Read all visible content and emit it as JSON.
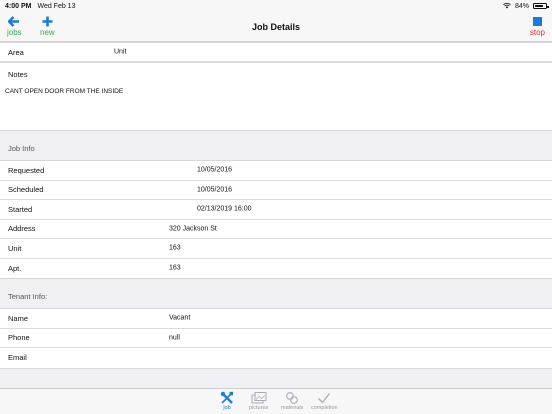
{
  "status_bar": {
    "time": "4:00 PM",
    "date": "Wed Feb 13",
    "battery": "84%",
    "battery_level": 0.84
  },
  "nav": {
    "back_label": "jobs",
    "new_label": "new",
    "title": "Job Details",
    "stop_label": "stop"
  },
  "details": {
    "area_label": "Area",
    "area_value": "Unit",
    "notes_label": "Notes",
    "notes_text": "CANT OPEN DOOR FROM THE INSIDE"
  },
  "job_info": {
    "header": "Job Info",
    "requested_label": "Requested",
    "requested_value": "10/05/2016",
    "scheduled_label": "Scheduled",
    "scheduled_value": "10/05/2016",
    "started_label": "Started",
    "started_value": "02/13/2019 16:00",
    "address_label": "Address",
    "address_value": "320 Jackson St",
    "unit_label": "Unit",
    "unit_value": "163",
    "apt_label": "Apt.",
    "apt_value": "163"
  },
  "tenant_info": {
    "header": "Tenant Info:",
    "name_label": "Name",
    "name_value": "Vacant",
    "phone_label": "Phone",
    "phone_value": "null",
    "email_label": "Email",
    "email_value": ""
  },
  "tabs": {
    "job": "job",
    "pictures": "pictures",
    "materials": "materials",
    "completion": "completion"
  },
  "colors": {
    "accent_blue": "#1f7bd8",
    "green": "#34a853",
    "red": "#e5322d"
  }
}
